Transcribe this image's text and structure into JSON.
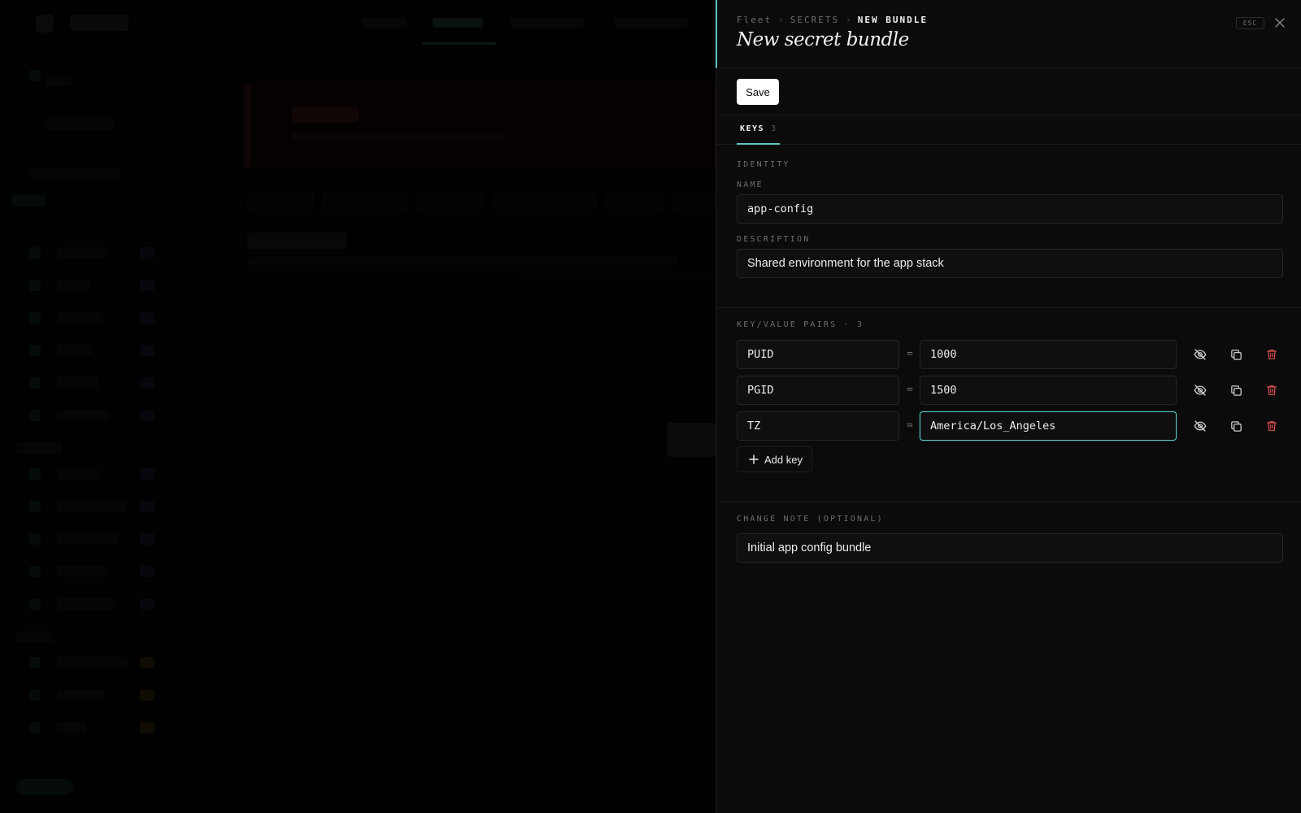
{
  "drawer": {
    "breadcrumb": [
      "Fleet",
      "SECRETS",
      "NEW BUNDLE"
    ],
    "title": "New secret bundle",
    "esc_label": "ESC",
    "save_label": "Save",
    "tab": {
      "label": "KEYS",
      "count": "3"
    },
    "identity": {
      "section_label": "IDENTITY",
      "name_label": "NAME",
      "name_value": "app-config",
      "description_label": "DESCRIPTION",
      "description_value": "Shared environment for the app stack"
    },
    "pairs": {
      "section_label": "KEY/VALUE PAIRS · 3",
      "rows": [
        {
          "key": "PUID",
          "value": "1000"
        },
        {
          "key": "PGID",
          "value": "1500"
        },
        {
          "key": "TZ",
          "value": "America/Los_Angeles"
        }
      ],
      "separator": "=",
      "add_label": "Add key"
    },
    "change_note": {
      "label": "CHANGE NOTE (OPTIONAL)",
      "value": "Initial app config bundle"
    }
  },
  "icons": {
    "close": "close-icon",
    "visibility": "eye-off-icon",
    "copy": "copy-icon",
    "delete": "trash-icon",
    "add": "plus-icon"
  },
  "colors": {
    "accent": "#5ec8c4",
    "danger": "#e05252",
    "panel_bg": "#0b0b0b",
    "input_bg": "#0f0f0f"
  }
}
